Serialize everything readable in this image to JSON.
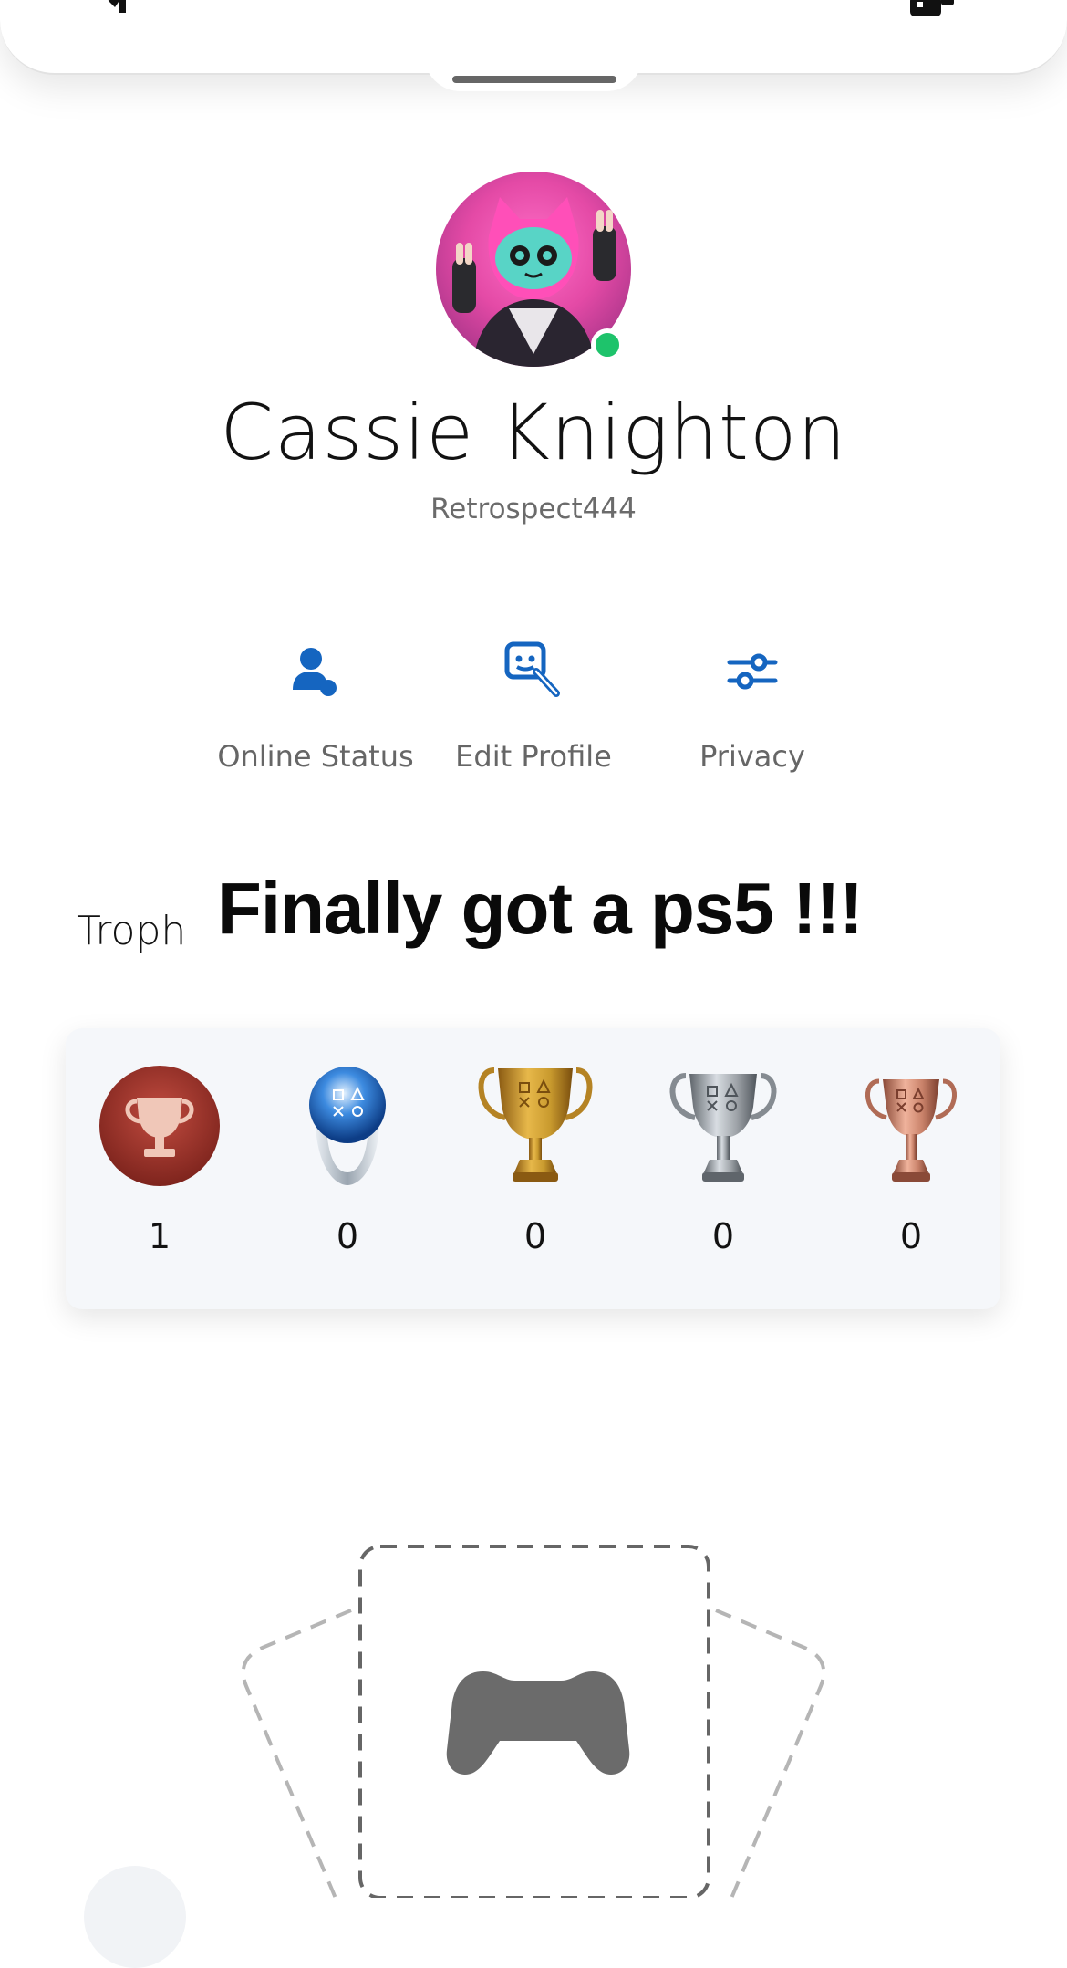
{
  "profile": {
    "display_name": "Cassie Knighton",
    "online_id": "Retrospect444",
    "online_status_color": "#1ec36b"
  },
  "actions": [
    {
      "label": "Online Status",
      "icon": "online-status-icon"
    },
    {
      "label": "Edit Profile",
      "icon": "edit-profile-icon"
    },
    {
      "label": "Privacy",
      "icon": "sliders-icon"
    }
  ],
  "trophies": {
    "section_title": "Troph",
    "overlay_caption": "Finally got a ps5 !!!",
    "counts": [
      {
        "type": "trophy-level",
        "count": "1"
      },
      {
        "type": "platinum",
        "count": "0"
      },
      {
        "type": "gold",
        "count": "0"
      },
      {
        "type": "silver",
        "count": "0"
      },
      {
        "type": "bronze",
        "count": "0"
      }
    ]
  },
  "games": {
    "placeholder_icon": "controller-icon"
  },
  "colors": {
    "accent_blue": "#1565c0",
    "level_red": "#a2352c",
    "gold": "#c99a2e",
    "silver": "#9ea3a8",
    "bronze": "#c9826a"
  }
}
